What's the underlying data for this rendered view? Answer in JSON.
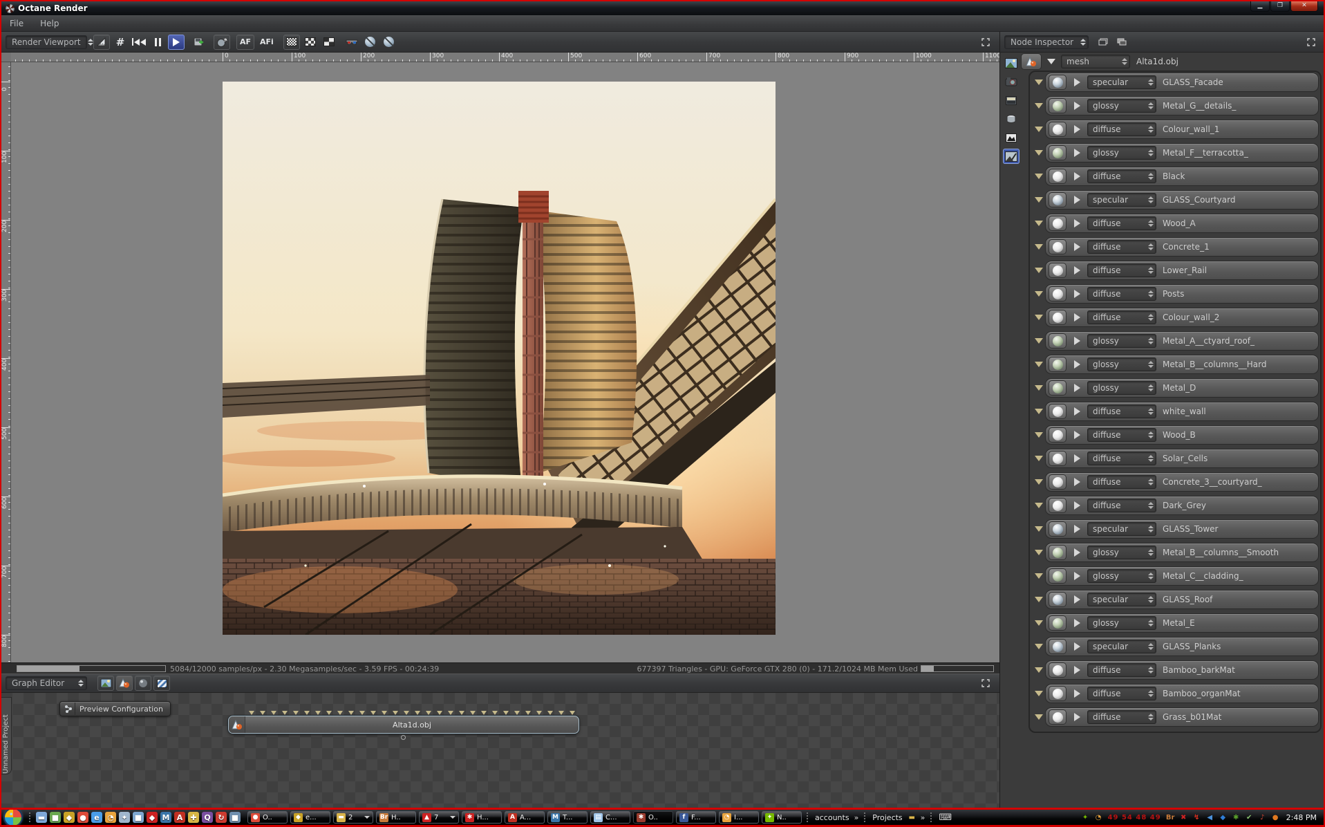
{
  "window": {
    "title": "Octane Render",
    "menus": [
      {
        "label": "File"
      },
      {
        "label": "Help"
      }
    ]
  },
  "viewport": {
    "selector": "Render Viewport",
    "af_label": "AF",
    "afi_label": "AFi",
    "ruler_top": [
      "0",
      "100",
      "200",
      "300",
      "400",
      "500",
      "600",
      "700",
      "800",
      "900",
      "1000",
      "1100"
    ],
    "ruler_left": [
      "0",
      "100",
      "200",
      "300",
      "400",
      "500",
      "600",
      "700",
      "800"
    ]
  },
  "status": {
    "left": "5084/12000 samples/px - 2.30 Megasamples/sec - 3.59 FPS - 00:24:39",
    "right": "677397 Triangles - GPU: GeForce GTX 280 (0) - 171.2/1024 MB Mem Used",
    "samples_done": 5084,
    "samples_total": 12000,
    "mem_used_mb": 171.2,
    "mem_total_mb": 1024
  },
  "graph": {
    "selector": "Graph Editor",
    "project_tab": "Unnamed Project",
    "preview_button": "Preview Configuration",
    "node_label": "Alta1d.obj",
    "pin_count": 30
  },
  "inspector": {
    "selector": "Node Inspector",
    "mesh_type": "mesh",
    "mesh_name": "Alta1d.obj",
    "materials": [
      {
        "type": "specular",
        "name": "GLASS_Facade"
      },
      {
        "type": "glossy",
        "name": "Metal_G__details_"
      },
      {
        "type": "diffuse",
        "name": "Colour_wall_1"
      },
      {
        "type": "glossy",
        "name": "Metal_F__terracotta_"
      },
      {
        "type": "diffuse",
        "name": "Black"
      },
      {
        "type": "specular",
        "name": "GLASS_Courtyard"
      },
      {
        "type": "diffuse",
        "name": "Wood_A"
      },
      {
        "type": "diffuse",
        "name": "Concrete_1"
      },
      {
        "type": "diffuse",
        "name": "Lower_Rail"
      },
      {
        "type": "diffuse",
        "name": "Posts"
      },
      {
        "type": "diffuse",
        "name": "Colour_wall_2"
      },
      {
        "type": "glossy",
        "name": "Metal_A__ctyard_roof_"
      },
      {
        "type": "glossy",
        "name": "Metal_B__columns__Hard"
      },
      {
        "type": "glossy",
        "name": "Metal_D"
      },
      {
        "type": "diffuse",
        "name": "white_wall"
      },
      {
        "type": "diffuse",
        "name": "Wood_B"
      },
      {
        "type": "diffuse",
        "name": "Solar_Cells"
      },
      {
        "type": "diffuse",
        "name": "Concrete_3__courtyard_"
      },
      {
        "type": "diffuse",
        "name": "Dark_Grey"
      },
      {
        "type": "specular",
        "name": "GLASS_Tower"
      },
      {
        "type": "glossy",
        "name": "Metal_B__columns__Smooth"
      },
      {
        "type": "glossy",
        "name": "Metal_C__cladding_"
      },
      {
        "type": "specular",
        "name": "GLASS_Roof"
      },
      {
        "type": "glossy",
        "name": "Metal_E"
      },
      {
        "type": "specular",
        "name": "GLASS_Planks"
      },
      {
        "type": "diffuse",
        "name": "Bamboo_barkMat"
      },
      {
        "type": "diffuse",
        "name": "Bamboo_organMat"
      },
      {
        "type": "diffuse",
        "name": "Grass_b01Mat"
      }
    ]
  },
  "taskbar": {
    "quick_launch": [
      {
        "name": "show-desktop-icon",
        "glyph": "▬",
        "color": "#7fa8d8"
      },
      {
        "name": "media-player-icon",
        "glyph": "■",
        "color": "#6aa84f"
      },
      {
        "name": "security-lock-icon",
        "glyph": "◆",
        "color": "#c9a227"
      },
      {
        "name": "chrome-icon",
        "glyph": "●",
        "color": "#dd4b39"
      },
      {
        "name": "internet-explorer-icon",
        "glyph": "e",
        "color": "#4a9de8"
      },
      {
        "name": "sync-clock-icon",
        "glyph": "◔",
        "color": "#e8a33d"
      },
      {
        "name": "network-places-icon",
        "glyph": "✦",
        "color": "#9fb6cc"
      },
      {
        "name": "computer-icon",
        "glyph": "■",
        "color": "#7fa8d0"
      },
      {
        "name": "red-swoosh-icon",
        "glyph": "◆",
        "color": "#cc2222"
      },
      {
        "name": "3dsmax-icon",
        "glyph": "M",
        "color": "#3a75a8"
      },
      {
        "name": "autocad-icon",
        "glyph": "A",
        "color": "#c03022"
      },
      {
        "name": "toolbox-icon",
        "glyph": "✚",
        "color": "#d6b545"
      },
      {
        "name": "qq-icon",
        "glyph": "Q",
        "color": "#7a4fa0"
      },
      {
        "name": "refresh-icon",
        "glyph": "↻",
        "color": "#cc3b2f"
      },
      {
        "name": "remote-desktop-icon",
        "glyph": "■",
        "color": "#6f8fae"
      }
    ],
    "windows": [
      {
        "name": "chrome-window",
        "glyph": "●",
        "color": "#dd4b39",
        "label": "O.."
      },
      {
        "name": "lock-window",
        "glyph": "◆",
        "color": "#c9a227",
        "label": "e..."
      },
      {
        "name": "folder-group-window",
        "glyph": "▬",
        "color": "#d9b44a",
        "label": "2",
        "group": true
      },
      {
        "name": "bridge-window",
        "glyph": "Br",
        "color": "#c77b3a",
        "label": "H.."
      },
      {
        "name": "acrobat-window",
        "glyph": "▲",
        "color": "#cc2222",
        "label": "7",
        "group": true
      },
      {
        "name": "paint-window",
        "glyph": "✱",
        "color": "#cc2222",
        "label": "H..."
      },
      {
        "name": "autocad-window",
        "glyph": "A",
        "color": "#c03022",
        "label": "A..."
      },
      {
        "name": "3dsmax-window",
        "glyph": "M",
        "color": "#3a75a8",
        "label": "T..."
      },
      {
        "name": "notepad-window",
        "glyph": "▤",
        "color": "#9fc4e8",
        "label": "C..."
      },
      {
        "name": "octane-window",
        "glyph": "✱",
        "color": "#9a3b2e",
        "label": "O..",
        "active": true
      },
      {
        "name": "facebook-window",
        "glyph": "f",
        "color": "#3b5998",
        "label": "F..."
      },
      {
        "name": "scheduler-window",
        "glyph": "◔",
        "color": "#e8a33d",
        "label": "I..."
      },
      {
        "name": "nvidia-window",
        "glyph": "✦",
        "color": "#76b900",
        "label": "N.."
      }
    ],
    "toolbar_labels": [
      {
        "label": "accounts"
      },
      {
        "label": "Projects"
      }
    ],
    "tray": [
      {
        "name": "nvidia-tray-icon",
        "glyph": "✦",
        "color": "#76b900"
      },
      {
        "name": "time-sync-icon",
        "glyph": "◔",
        "color": "#e8a33d"
      },
      {
        "name": "bridge-tray-icon",
        "glyph": "Br",
        "color": "#c77b3a"
      },
      {
        "name": "security-alert-icon",
        "glyph": "✖",
        "color": "#cc2222"
      },
      {
        "name": "download-bolt-icon",
        "glyph": "↯",
        "color": "#e03020"
      },
      {
        "name": "messenger-icon",
        "glyph": "◀",
        "color": "#4a90d9"
      },
      {
        "name": "dropbox-icon",
        "glyph": "◆",
        "color": "#2f7cd6"
      },
      {
        "name": "settings-gear-icon",
        "glyph": "✱",
        "color": "#5aa02c"
      },
      {
        "name": "display-ok-icon",
        "glyph": "✔",
        "color": "#88c070"
      },
      {
        "name": "audio-manager-icon",
        "glyph": "♪",
        "color": "#cc4433"
      },
      {
        "name": "update-icon",
        "glyph": "●",
        "color": "#e07820"
      }
    ],
    "tray_digits": "49 54 48 49",
    "clock": "2:48 PM"
  }
}
